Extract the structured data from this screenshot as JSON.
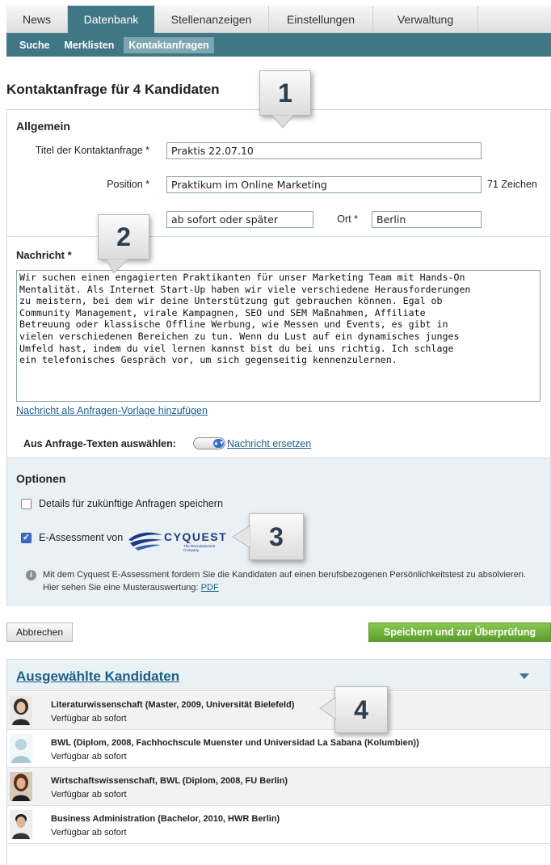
{
  "nav": {
    "main_tabs": [
      {
        "label": "News"
      },
      {
        "label": "Datenbank"
      },
      {
        "label": "Stellenanzeigen"
      },
      {
        "label": "Einstellungen"
      },
      {
        "label": "Verwaltung"
      }
    ],
    "active_main": "Datenbank",
    "sub_tabs": [
      {
        "label": "Suche"
      },
      {
        "label": "Merklisten"
      },
      {
        "label": "Kontaktanfragen"
      }
    ],
    "active_sub": "Kontaktanfragen"
  },
  "page_title": "Kontaktanfrage für 4 Kandidaten",
  "general": {
    "title": "Allgemein",
    "titel_label": "Titel der Kontaktanfrage *",
    "titel_value": "Praktis 22.07.10",
    "position_label": "Position *",
    "position_value": "Praktikum im Online Marketing",
    "char_count": "71 Zeichen",
    "start_value": "ab sofort oder später",
    "ort_label": "Ort *",
    "ort_value": "Berlin"
  },
  "message": {
    "title": "Nachricht *",
    "body": "Wir suchen einen engagierten Praktikanten für unser Marketing Team mit Hands-On\nMentalität. Als Internet Start-Up haben wir viele verschiedene Herausforderungen\nzu meistern, bei dem wir deine Unterstützung gut gebrauchen können. Egal ob\nCommunity Management, virale Kampagnen, SEO und SEM Maßnahmen, Affiliate\nBetreuung oder klassische Offline Werbung, wie Messen und Events, es gibt in\nvielen verschiedenen Bereichen zu tun. Wenn du Lust auf ein dynamisches junges\nUmfeld hast, indem du viel lernen kannst bist du bei uns richtig. Ich schlage\nein telefonisches Gespräch vor, um sich gegenseitig kennenzulernen.",
    "add_template_link": "Nachricht als Anfragen-Vorlage hinzufügen",
    "select_label": "Aus Anfrage-Texten auswählen:",
    "replace_link": "Nachricht ersetzen"
  },
  "options": {
    "title": "Optionen",
    "save_details_label": "Details für zukünftige Anfragen speichern",
    "save_details_checked": false,
    "assessment_label": "E-Assessment von",
    "assessment_checked": true,
    "logo_text": "CYQUEST",
    "logo_tagline": "The Recruitainment Company",
    "info_text": "Mit dem Cyquest E-Assessment fordern Sie die Kandidaten auf einen berufsbezogenen Persönlichkeitstest zu absolvieren. Hier sehen Sie eine Musterauswertung: ",
    "info_link": "PDF"
  },
  "buttons": {
    "cancel": "Abbrechen",
    "save": "Speichern und zur Überprüfung"
  },
  "callouts": [
    "1",
    "2",
    "3",
    "4"
  ],
  "candidates": {
    "title": "Ausgewählte Kandidaten",
    "items": [
      {
        "name": "Literaturwissenschaft (Master, 2009, Universität Bielefeld)",
        "availability": "Verfügbar ab sofort",
        "avatar": "photo-woman"
      },
      {
        "name": "BWL (Diplom, 2008, Fachhochscule Muenster und Universidad La Sabana (Kolumbien))",
        "availability": "Verfügbar ab sofort",
        "avatar": "placeholder-avatar"
      },
      {
        "name": "Wirtschaftswissenschaft, BWL (Diplom, 2008, FU Berlin)",
        "availability": "Verfügbar ab sofort",
        "avatar": "photo-woman"
      },
      {
        "name": "Business Administration (Bachelor, 2010, HWR Berlin)",
        "availability": "Verfügbar ab sofort",
        "avatar": "photo-man"
      }
    ]
  },
  "colors": {
    "nav_active": "#3f7786",
    "link": "#1a5f87",
    "save_button": "#6cb13a",
    "options_bg": "#e9f1f4"
  }
}
